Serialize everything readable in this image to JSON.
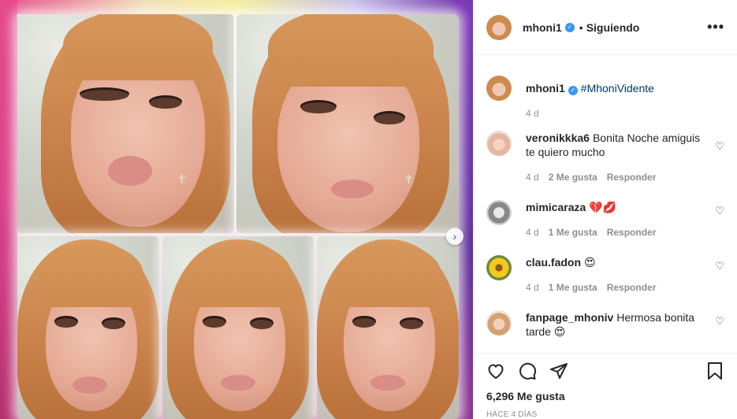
{
  "post": {
    "author": "mhoni1",
    "follow_status": "Siguiendo",
    "more_label": "•••",
    "caption": {
      "username": "mhoni1",
      "hashtag": "#MhoniVidente",
      "time": "4 d"
    },
    "comments": [
      {
        "username": "veronikkka6",
        "text": "Bonita Noche amiguis te quiero mucho",
        "time": "4 d",
        "likes": "2 Me gusta",
        "reply": "Responder"
      },
      {
        "username": "mimicaraza",
        "text": "💔💋",
        "time": "4 d",
        "likes": "1 Me gusta",
        "reply": "Responder"
      },
      {
        "username": "clau.fadon",
        "text": "😍",
        "time": "4 d",
        "likes": "1 Me gusta",
        "reply": "Responder"
      },
      {
        "username": "fanpage_mhoniv",
        "text": "Hermosa bonita tarde 😍",
        "time": "",
        "likes": "",
        "reply": ""
      }
    ],
    "likes_count": "6,296 Me gusta",
    "posted": "HACE 4 DÍAS"
  },
  "icons": {
    "verified": "verified-badge-icon",
    "like": "heart-outline-icon",
    "comment": "speech-bubble-icon",
    "share": "paper-plane-icon",
    "save": "bookmark-icon",
    "next": "chevron-right-icon"
  },
  "colors": {
    "accent": "#3897f0",
    "text": "#262626",
    "muted": "#8e8e8e",
    "hashtag": "#00376b"
  }
}
